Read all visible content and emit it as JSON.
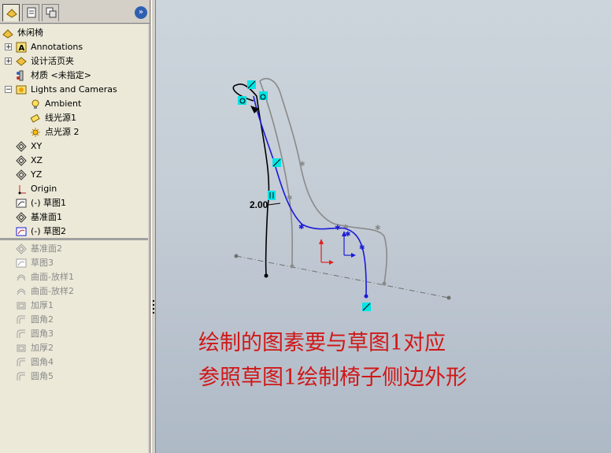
{
  "feature_tree": {
    "tabs": [
      "feature-manager",
      "property-manager",
      "configuration-manager"
    ],
    "collapse_glyph": "»",
    "root": "休闲椅",
    "items": [
      {
        "label": "Annotations",
        "icon": "annotations-icon",
        "expander": "+",
        "level": 1,
        "state": "normal"
      },
      {
        "label": "设计活页夹",
        "icon": "design-binder-icon",
        "expander": "+",
        "level": 1,
        "state": "normal"
      },
      {
        "label": "材质 <未指定>",
        "icon": "material-icon",
        "expander": "",
        "level": 1,
        "state": "normal"
      },
      {
        "label": "Lights and Cameras",
        "icon": "lights-cameras-icon",
        "expander": "−",
        "level": 1,
        "state": "normal"
      },
      {
        "label": "Ambient",
        "icon": "ambient-light-icon",
        "expander": "",
        "level": 2,
        "state": "normal"
      },
      {
        "label": "线光源1",
        "icon": "directional-light-icon",
        "expander": "",
        "level": 2,
        "state": "normal"
      },
      {
        "label": "点光源 2",
        "icon": "point-light-icon",
        "expander": "",
        "level": 2,
        "state": "normal"
      },
      {
        "label": "XY",
        "icon": "plane-icon",
        "expander": "",
        "level": 1,
        "state": "normal"
      },
      {
        "label": "XZ",
        "icon": "plane-icon",
        "expander": "",
        "level": 1,
        "state": "normal"
      },
      {
        "label": "YZ",
        "icon": "plane-icon",
        "expander": "",
        "level": 1,
        "state": "normal"
      },
      {
        "label": "Origin",
        "icon": "origin-icon",
        "expander": "",
        "level": 1,
        "state": "normal"
      },
      {
        "label": "(-) 草图1",
        "icon": "sketch-icon",
        "expander": "",
        "level": 1,
        "state": "normal"
      },
      {
        "label": "基准面1",
        "icon": "plane-icon",
        "expander": "",
        "level": 1,
        "state": "normal"
      },
      {
        "label": "(-) 草图2",
        "icon": "active-sketch-icon",
        "expander": "",
        "level": 1,
        "state": "normal"
      },
      {
        "label": "基准面2",
        "icon": "plane-icon",
        "expander": "",
        "level": 1,
        "state": "suppressed"
      },
      {
        "label": "草图3",
        "icon": "sketch-icon",
        "expander": "",
        "level": 1,
        "state": "suppressed"
      },
      {
        "label": "曲面-放样1",
        "icon": "surface-loft-icon",
        "expander": "",
        "level": 1,
        "state": "suppressed"
      },
      {
        "label": "曲面-放样2",
        "icon": "surface-loft-icon",
        "expander": "",
        "level": 1,
        "state": "suppressed"
      },
      {
        "label": "加厚1",
        "icon": "thicken-icon",
        "expander": "",
        "level": 1,
        "state": "suppressed"
      },
      {
        "label": "圆角2",
        "icon": "fillet-icon",
        "expander": "",
        "level": 1,
        "state": "suppressed"
      },
      {
        "label": "圆角3",
        "icon": "fillet-icon",
        "expander": "",
        "level": 1,
        "state": "suppressed"
      },
      {
        "label": "加厚2",
        "icon": "thicken-icon",
        "expander": "",
        "level": 1,
        "state": "suppressed"
      },
      {
        "label": "圆角4",
        "icon": "fillet-icon",
        "expander": "",
        "level": 1,
        "state": "suppressed"
      },
      {
        "label": "圆角5",
        "icon": "fillet-icon",
        "expander": "",
        "level": 1,
        "state": "suppressed"
      }
    ]
  },
  "viewport": {
    "dimension_label": "2.00",
    "note_line1": "绘制的图素要与草图1对应",
    "note_line2": "参照草图1绘制椅子侧边外形",
    "colors": {
      "annotation": "#d01818",
      "active_sketch": "#1a1ad8",
      "reference": "#8a8a8a",
      "relation_marker": "#00e5e5"
    }
  }
}
